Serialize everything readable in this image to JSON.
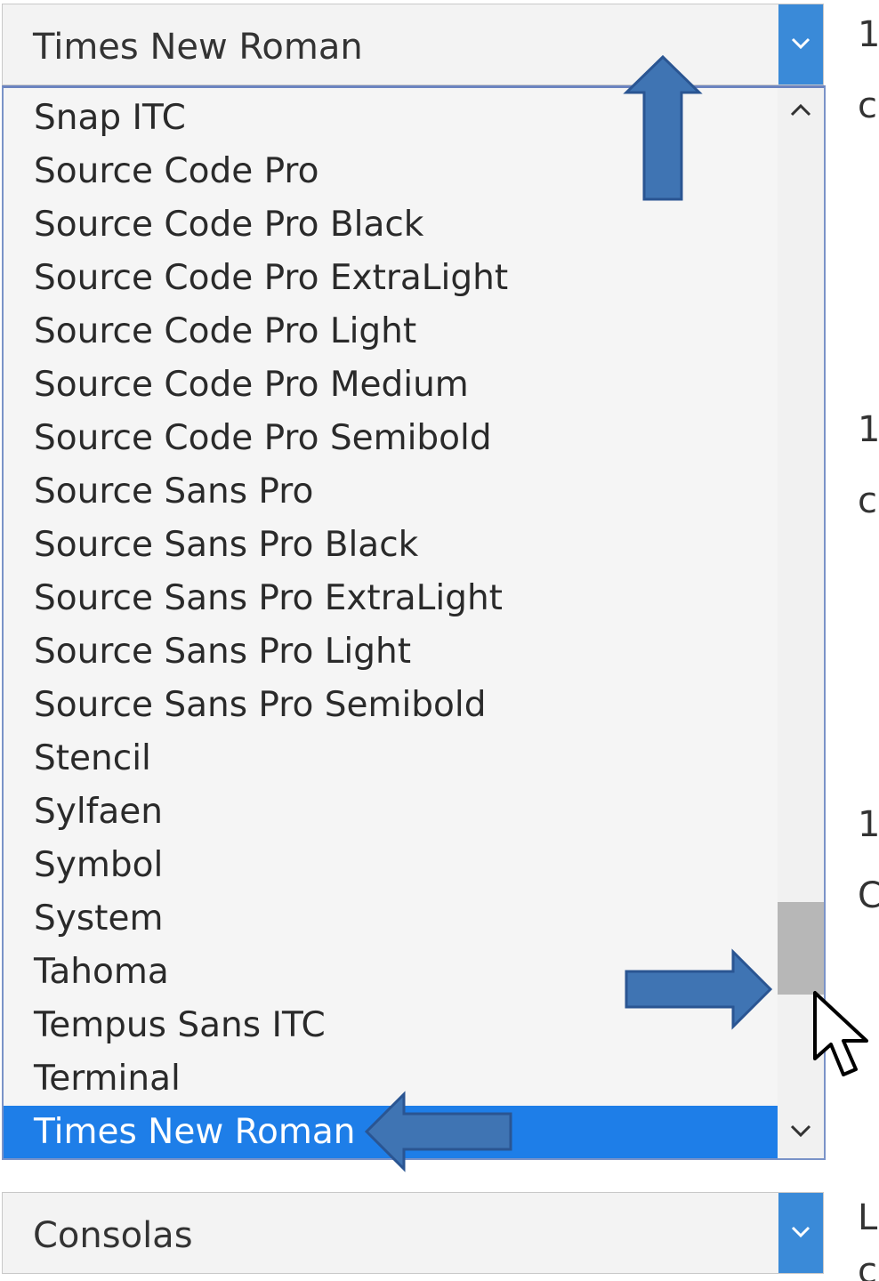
{
  "font_select_top": {
    "value": "Times New Roman",
    "dropdown_icon": "chevron-down-icon"
  },
  "font_list": {
    "items": [
      "Snap ITC",
      "Source Code Pro",
      "Source Code Pro Black",
      "Source Code Pro ExtraLight",
      "Source Code Pro Light",
      "Source Code Pro Medium",
      "Source Code Pro Semibold",
      "Source Sans Pro",
      "Source Sans Pro Black",
      "Source Sans Pro ExtraLight",
      "Source Sans Pro Light",
      "Source Sans Pro Semibold",
      "Stencil",
      "Sylfaen",
      "Symbol",
      "System",
      "Tahoma",
      "Tempus Sans ITC",
      "Terminal",
      "Times New Roman"
    ],
    "selected": "Times New Roman",
    "scroll_up_icon": "chevron-up-icon",
    "scroll_down_icon": "chevron-down-icon",
    "scroll_position": 0.87
  },
  "font_select_bottom": {
    "value": "Consolas",
    "dropdown_icon": "chevron-down-icon"
  },
  "right_edge_text": [
    "1",
    "c",
    "1",
    "c",
    "1",
    "C",
    "L",
    "c"
  ],
  "colors": {
    "accent": "#3a8ad8",
    "selection": "#1e7ee8",
    "annotation_arrow": "#3f74b3"
  }
}
